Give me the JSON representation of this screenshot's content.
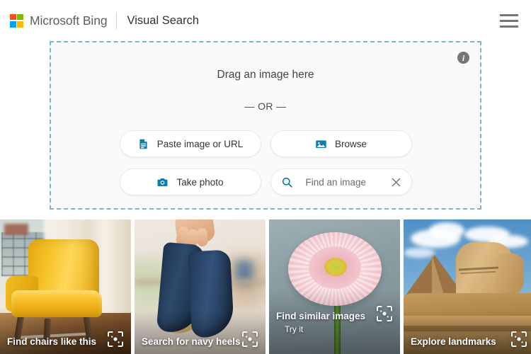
{
  "header": {
    "brand": "Microsoft Bing",
    "product": "Visual Search",
    "logo_colors": {
      "top_left": "#F25022",
      "top_right": "#7FBA00",
      "bottom_left": "#00A4EF",
      "bottom_right": "#FFB900"
    },
    "menu_icon": "hamburger-menu-icon"
  },
  "dropzone": {
    "drag_text": "Drag an image here",
    "or_text": "— OR —",
    "info_icon": "info-icon",
    "info_glyph": "i",
    "border_color": "#7fb2cb",
    "buttons": [
      {
        "label": "Paste image or URL",
        "icon": "paste-icon"
      },
      {
        "label": "Browse",
        "icon": "image-icon"
      },
      {
        "label": "Take photo",
        "icon": "camera-icon"
      }
    ],
    "search": {
      "placeholder": "Find an image",
      "value": "",
      "icon": "search-icon",
      "clear_icon": "close-icon"
    },
    "accent_color": "#0f7cac"
  },
  "cards": [
    {
      "title": "Find chairs like this",
      "subtitle": "",
      "icon": "visual-search-icon",
      "art": "yellow-armchair-by-window"
    },
    {
      "title": "Search for navy heels",
      "subtitle": "",
      "icon": "visual-search-icon",
      "art": "navy-high-heels-in-hand"
    },
    {
      "title": "Find similar images",
      "subtitle": "Try it",
      "icon": "visual-search-icon",
      "art": "pink-gerbera-daisy"
    },
    {
      "title": "Explore landmarks",
      "subtitle": "",
      "icon": "visual-search-icon",
      "art": "great-sphinx-of-giza"
    }
  ]
}
